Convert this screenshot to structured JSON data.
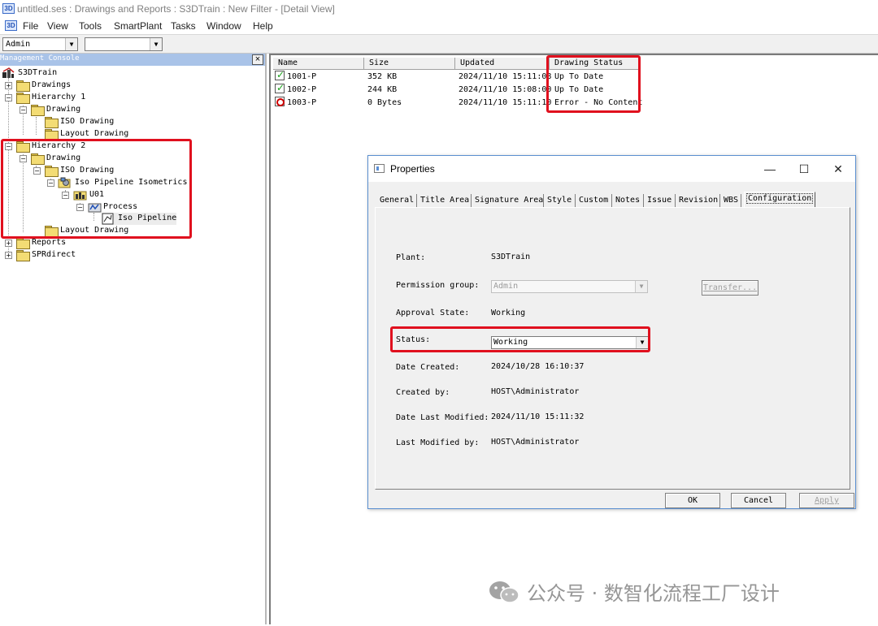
{
  "window": {
    "title": "untitled.ses : Drawings and Reports : S3DTrain : New Filter - [Detail View]",
    "app_icon": "3D"
  },
  "menu": [
    "File",
    "View",
    "Tools",
    "SmartPlant",
    "Tasks",
    "Window",
    "Help"
  ],
  "toolbar": {
    "permission_combo": "Admin",
    "second_combo": ""
  },
  "management_console": {
    "title": "Management Console",
    "close": "×",
    "tree": {
      "root": "S3DTrain",
      "drawings": "Drawings",
      "hierarchy1": "Hierarchy 1",
      "h1_drawing": "Drawing",
      "h1_iso_drawing": "ISO Drawing",
      "h1_layout_drawing": "Layout Drawing",
      "hierarchy2": "Hierarchy 2",
      "h2_drawing": "Drawing",
      "h2_iso_drawing": "ISO Drawing",
      "iso_pipeline_isometrics": "Iso Pipeline Isometrics",
      "u01": "U01",
      "process": "Process",
      "iso_pipeline": "Iso Pipeline",
      "h2_layout_drawing": "Layout Drawing",
      "reports": "Reports",
      "sprdirect": "SPRdirect"
    }
  },
  "detail_list": {
    "columns": [
      "Name",
      "Size",
      "Updated",
      "Drawing Status"
    ],
    "rows": [
      {
        "name": "1001-P",
        "size": "352 KB",
        "updated": "2024/11/10 15:11:08",
        "status": "Up To Date",
        "icon": "check"
      },
      {
        "name": "1002-P",
        "size": "244 KB",
        "updated": "2024/11/10 15:08:00",
        "status": "Up To Date",
        "icon": "check"
      },
      {
        "name": "1003-P",
        "size": "0 Bytes",
        "updated": "2024/11/10 15:11:10",
        "status": "Error - No Content",
        "icon": "error"
      }
    ]
  },
  "properties_dialog": {
    "title": "Properties",
    "tabs": [
      "General",
      "Title Area",
      "Signature Area",
      "Style",
      "Custom",
      "Notes",
      "Issue",
      "Revision",
      "WBS",
      "Configuration"
    ],
    "active_tab": "Configuration",
    "fields": {
      "plant_label": "Plant:",
      "plant_value": "S3DTrain",
      "permission_label": "Permission group:",
      "permission_value": "Admin",
      "transfer_button": "Transfer...",
      "approval_label": "Approval State:",
      "approval_value": "Working",
      "status_label": "Status:",
      "status_value": "Working",
      "date_created_label": "Date Created:",
      "date_created_value": "2024/10/28 16:10:37",
      "created_by_label": "Created by:",
      "created_by_value": "HOST\\Administrator",
      "date_modified_label": "Date Last Modified:",
      "date_modified_value": "2024/11/10 15:11:32",
      "modified_by_label": "Last Modified by:",
      "modified_by_value": "HOST\\Administrator"
    },
    "buttons": {
      "ok": "OK",
      "cancel": "Cancel",
      "apply": "Apply"
    }
  },
  "watermark": {
    "text": "公众号 · 数智化流程工厂设计"
  },
  "colors": {
    "highlight": "#e0101e",
    "panel_header": "#a9c3e8"
  }
}
